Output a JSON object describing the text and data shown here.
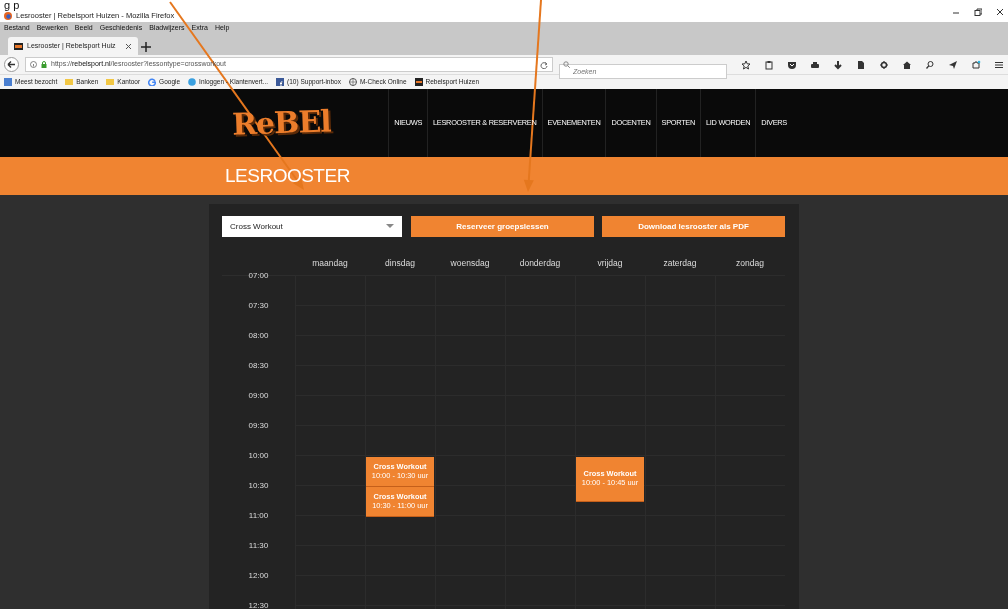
{
  "annotation": {
    "text": "g p"
  },
  "window": {
    "title": "Lesrooster | Rebelsport Huizen - Mozilla Firefox"
  },
  "menu": [
    "Bestand",
    "Bewerken",
    "Beeld",
    "Geschiedenis",
    "Bladwijzers",
    "Extra",
    "Help"
  ],
  "tabs": [
    {
      "label": "Lesrooster | Rebelsport Huiz",
      "selected": true
    }
  ],
  "address_bar": {
    "url": "https://**rebelsport.nl**/lesrooster?lessontype=crossworkout"
  },
  "search": {
    "placeholder": "Zoeken"
  },
  "bookmarks": [
    {
      "label": "Meest bezocht",
      "kind": "special"
    },
    {
      "label": "Banken",
      "kind": "folder"
    },
    {
      "label": "Kantoor",
      "kind": "folder"
    },
    {
      "label": "Google",
      "kind": "google"
    },
    {
      "label": "Inloggen - Klantenvert...",
      "kind": "site"
    },
    {
      "label": "(10) Support-inbox",
      "kind": "facebook"
    },
    {
      "label": "M-Check Online",
      "kind": "globe"
    },
    {
      "label": "Rebelsport Huizen",
      "kind": "rebel"
    }
  ],
  "site": {
    "logo": "ReBEl",
    "nav": [
      "NIEUWS",
      "LESROOSTER & RESERVEREN",
      "EVENEMENTEN",
      "DOCENTEN",
      "SPORTEN",
      "LID WORDEN",
      "DIVERS"
    ],
    "page_title": "LESROOSTER"
  },
  "filter": {
    "value": "Cross Workout"
  },
  "buttons": [
    "Reserveer groepslessen",
    "Download lesrooster als PDF"
  ],
  "schedule": {
    "times": [
      "07:00",
      "07:30",
      "08:00",
      "08:30",
      "09:00",
      "09:30",
      "10:00",
      "10:30",
      "11:00",
      "11:30",
      "12:00",
      "12:30"
    ],
    "days": [
      {
        "label": "maandag"
      },
      {
        "label": "dinsdag",
        "events": [
          {
            "title": "Cross Workout",
            "time": "10:00 - 10:30 uur"
          },
          {
            "title": "Cross Workout",
            "time": "10:30 - 11:00 uur"
          }
        ]
      },
      {
        "label": "woensdag"
      },
      {
        "label": "donderdag"
      },
      {
        "label": "vrijdag",
        "events": [
          {
            "title": "Cross Workout",
            "time": "10:00 - 10:45 uur"
          }
        ]
      },
      {
        "label": "zaterdag"
      },
      {
        "label": "zondag"
      }
    ]
  }
}
